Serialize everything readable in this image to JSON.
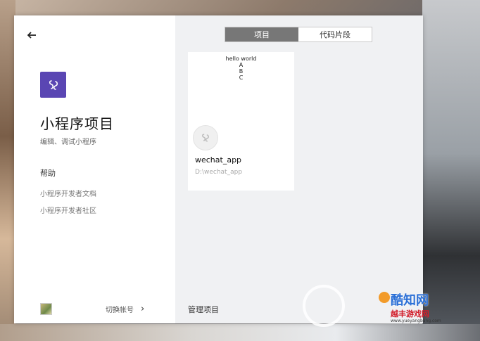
{
  "nav": {
    "back_label": "←"
  },
  "sidebar": {
    "title": "小程序项目",
    "subtitle": "编辑、调试小程序",
    "help_heading": "帮助",
    "links": [
      "小程序开发者文档",
      "小程序开发者社区"
    ],
    "switch_account_label": "切换帐号",
    "switch_arrow": "›"
  },
  "tabs": [
    {
      "label": "项目",
      "active": true
    },
    {
      "label": "代码片段",
      "active": false
    }
  ],
  "project_card": {
    "preview_lines": [
      "hello world",
      "A",
      "B",
      "C"
    ],
    "name": "wechat_app",
    "path": "D:\\wechat_app"
  },
  "footer": {
    "manage_label": "管理项目"
  },
  "watermark": {
    "brand": "酷知网",
    "sub": "越丰游戏网",
    "url": "www.yueyangbang.com"
  },
  "colors": {
    "logo_bg": "#5a46b3",
    "tab_active_bg": "#777777"
  }
}
